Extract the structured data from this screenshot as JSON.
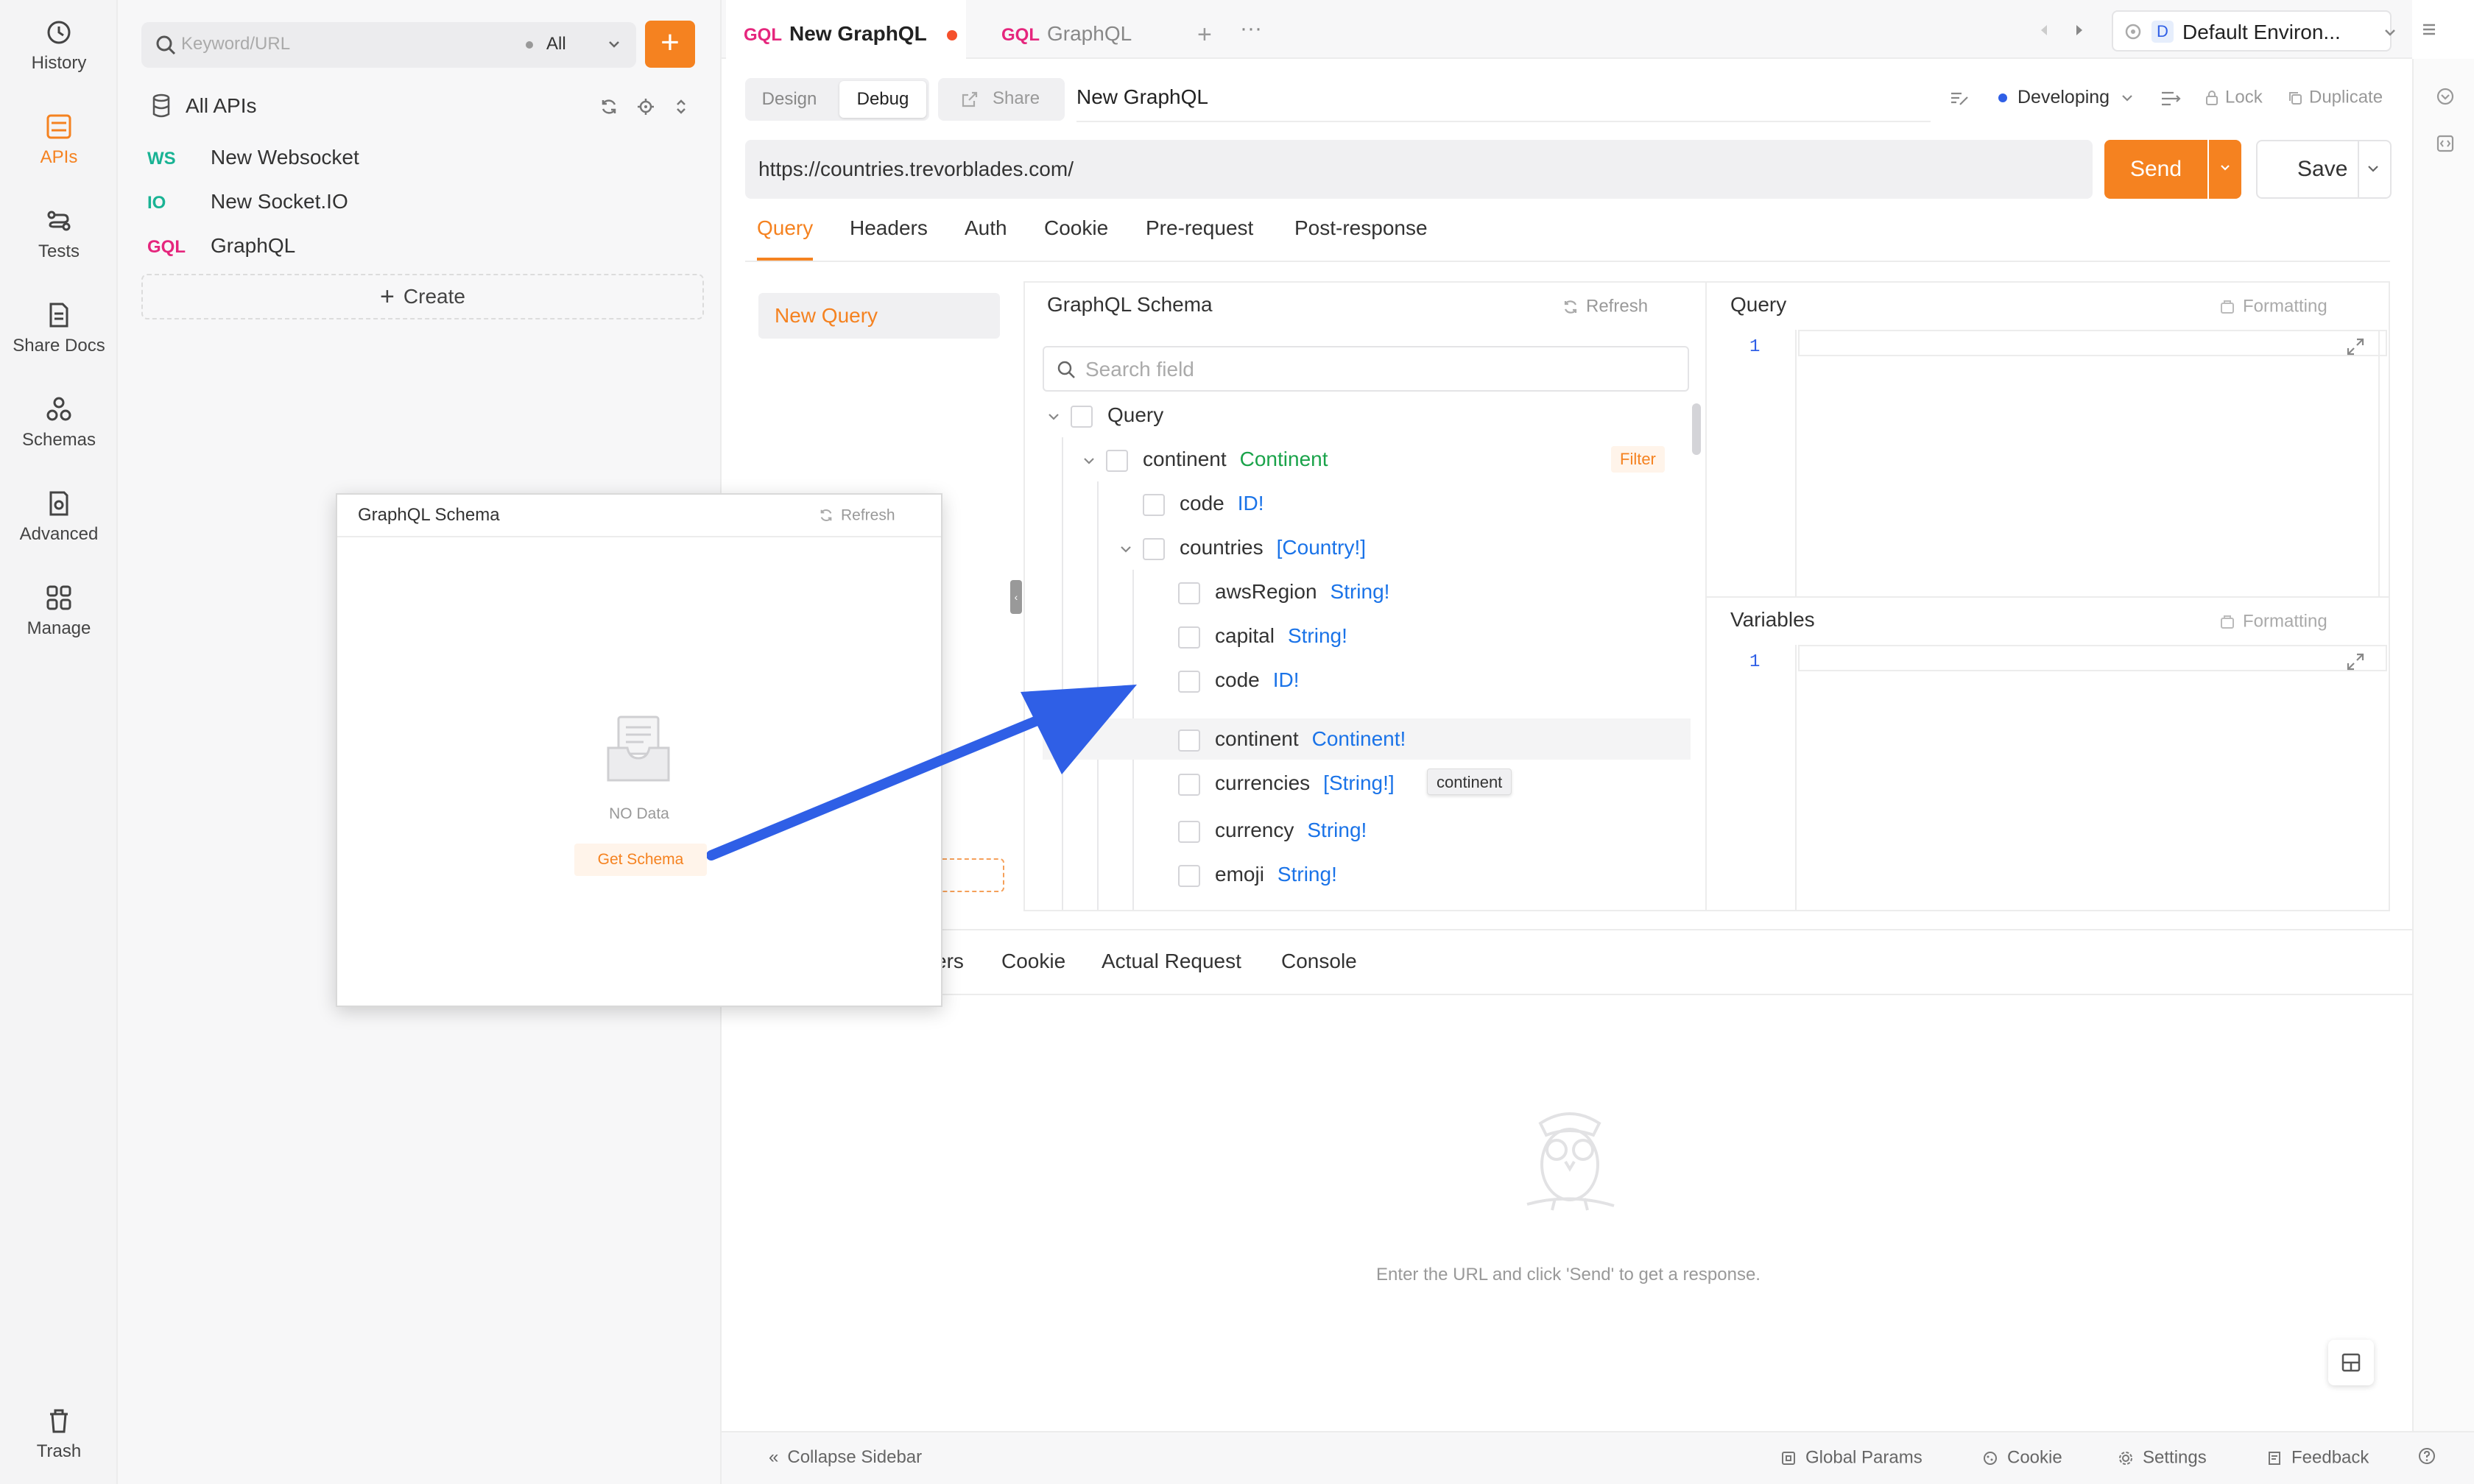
{
  "rail": {
    "items": [
      {
        "label": "History",
        "icon": "history-icon"
      },
      {
        "label": "APIs",
        "icon": "apis-icon"
      },
      {
        "label": "Tests",
        "icon": "tests-icon"
      },
      {
        "label": "Share Docs",
        "icon": "share-docs-icon"
      },
      {
        "label": "Schemas",
        "icon": "schemas-icon"
      },
      {
        "label": "Advanced",
        "icon": "advanced-icon"
      },
      {
        "label": "Manage",
        "icon": "manage-icon"
      }
    ],
    "trash": "Trash",
    "active_color": "#f58220"
  },
  "sidebar": {
    "search_placeholder": "Keyword/URL",
    "filter": "All",
    "all_apis": "All APIs",
    "items": [
      {
        "method": "WS",
        "name": "New Websocket",
        "color": "#19b394"
      },
      {
        "method": "IO",
        "name": "New Socket.IO",
        "color": "#19b394"
      },
      {
        "method": "GQL",
        "name": "GraphQL",
        "color": "#e5267d"
      }
    ],
    "create": "Create"
  },
  "tabs": [
    {
      "tag": "GQL",
      "label": "New GraphQL",
      "active": true
    },
    {
      "tag": "GQL",
      "label": "GraphQL",
      "active": false
    }
  ],
  "env": {
    "badge": "D",
    "label": "Default Environ..."
  },
  "toolbar": {
    "design": "Design",
    "debug": "Debug",
    "share": "Share",
    "name": "New GraphQL",
    "status": "Developing",
    "lock": "Lock",
    "duplicate": "Duplicate"
  },
  "request": {
    "url": "https://countries.trevorblades.com/",
    "send": "Send",
    "save": "Save"
  },
  "req_tabs": [
    "Query",
    "Headers",
    "Auth",
    "Cookie",
    "Pre-request",
    "Post-response"
  ],
  "query_list": {
    "item": "New Query"
  },
  "schema": {
    "title": "GraphQL Schema",
    "refresh": "Refresh",
    "search_placeholder": "Search field",
    "filter": "Filter",
    "tooltip": "continent",
    "rows": [
      {
        "name": "Query",
        "type": ""
      },
      {
        "name": "continent",
        "type": "Continent"
      },
      {
        "name": "code",
        "type": "ID!"
      },
      {
        "name": "countries",
        "type": "[Country!]"
      },
      {
        "name": "awsRegion",
        "type": "String!"
      },
      {
        "name": "capital",
        "type": "String!"
      },
      {
        "name": "code",
        "type": "ID!"
      },
      {
        "name": "continent",
        "type": "Continent!"
      },
      {
        "name": "currencies",
        "type": "[String!]"
      },
      {
        "name": "currency",
        "type": "String!"
      },
      {
        "name": "emoji",
        "type": "String!"
      }
    ]
  },
  "editors": {
    "query_title": "Query",
    "variables_title": "Variables",
    "formatting": "Formatting",
    "line": "1"
  },
  "response": {
    "tabs": [
      "ers",
      "Cookie",
      "Actual Request",
      "Console"
    ],
    "empty_text": "Enter the URL and click 'Send' to get a response."
  },
  "statusbar": {
    "collapse": "Collapse Sidebar",
    "global_params": "Global Params",
    "cookie": "Cookie",
    "settings": "Settings",
    "feedback": "Feedback"
  },
  "popup": {
    "title": "GraphQL Schema",
    "refresh": "Refresh",
    "no_data": "NO Data",
    "get_schema": "Get Schema"
  },
  "colors": {
    "accent": "#f58220",
    "type_blue": "#1a73e8",
    "type_green": "#1aa34a",
    "gql": "#e5267d",
    "arrow": "#2f5fe6"
  }
}
